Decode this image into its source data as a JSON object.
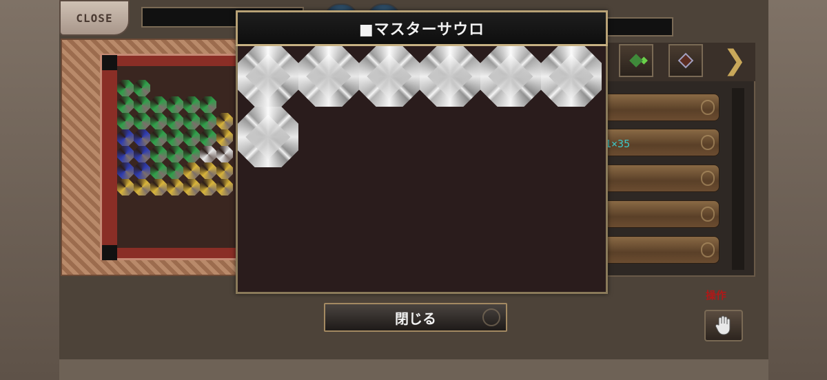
{
  "top_bar": {
    "close_label": "CLOSE"
  },
  "modal": {
    "title": "■マスターサウロ",
    "gem_count": 7,
    "close_button_label": "閉じる"
  },
  "right_panel": {
    "list_text": "1×35",
    "operation_label": "操作"
  },
  "icons": [
    "hand-icon",
    "move-gem-icon",
    "pointer-gem-icon",
    "next-arrow-icon"
  ],
  "colors": {
    "emerald": "#2fa04a",
    "sapphire": "#2e3cb0",
    "topaz": "#d8b43a",
    "diamond": "#e8e8e8",
    "operation_red": "#b01818",
    "list_text": "#3fc6c6"
  }
}
